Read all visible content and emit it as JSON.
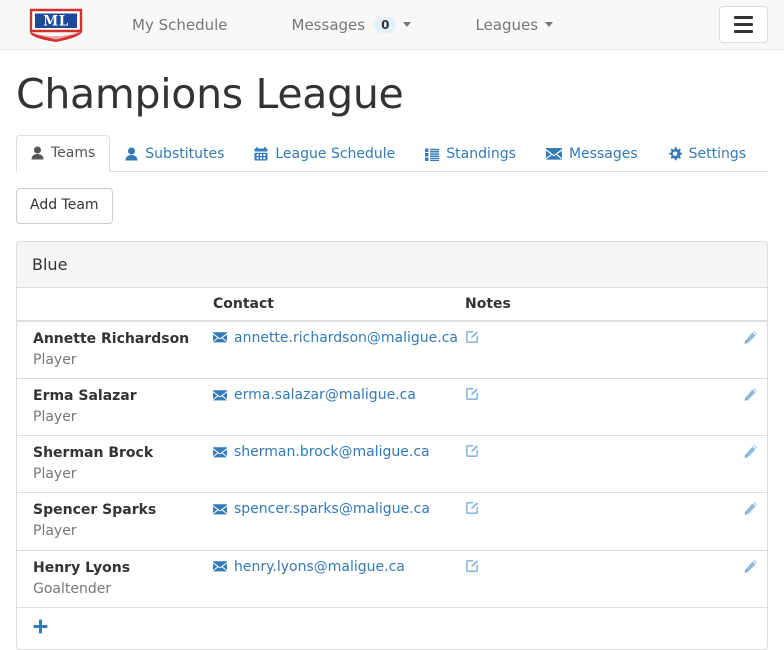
{
  "navbar": {
    "brand_text": "ML",
    "brand_icon": "ml-shield-logo",
    "links": [
      {
        "label": "My Schedule",
        "icon": null,
        "badge": null,
        "caret": false
      },
      {
        "label": "Messages",
        "icon": null,
        "badge": "0",
        "caret": true
      },
      {
        "label": "Leagues",
        "icon": null,
        "badge": null,
        "caret": true
      }
    ],
    "toggle_icon": "hamburger-icon"
  },
  "page": {
    "title": "Champions League"
  },
  "tabs": [
    {
      "label": "Teams",
      "icon": "user-icon",
      "active": true
    },
    {
      "label": "Substitutes",
      "icon": "user-icon",
      "active": false
    },
    {
      "label": "League Schedule",
      "icon": "calendar-icon",
      "active": false
    },
    {
      "label": "Standings",
      "icon": "list-icon",
      "active": false
    },
    {
      "label": "Messages",
      "icon": "envelope-icon",
      "active": false
    },
    {
      "label": "Settings",
      "icon": "gear-icon",
      "active": false
    }
  ],
  "toolbar": {
    "add_team_label": "Add Team"
  },
  "panel": {
    "team_name": "Blue",
    "columns": [
      "",
      "Contact",
      "Notes",
      ""
    ],
    "rows": [
      {
        "name": "Annette Richardson",
        "role": "Player",
        "email": "annette.richardson@maligue.ca",
        "notes_icon": "note-edit-icon",
        "edit_icon": "pencil-icon",
        "delete_icon": "remove-icon"
      },
      {
        "name": "Erma Salazar",
        "role": "Player",
        "email": "erma.salazar@maligue.ca",
        "notes_icon": "note-edit-icon",
        "edit_icon": "pencil-icon",
        "delete_icon": "remove-icon"
      },
      {
        "name": "Sherman Brock",
        "role": "Player",
        "email": "sherman.brock@maligue.ca",
        "notes_icon": "note-edit-icon",
        "edit_icon": "pencil-icon",
        "delete_icon": "remove-icon"
      },
      {
        "name": "Spencer Sparks",
        "role": "Player",
        "email": "spencer.sparks@maligue.ca",
        "notes_icon": "note-edit-icon",
        "edit_icon": "pencil-icon",
        "delete_icon": "remove-icon"
      },
      {
        "name": "Henry Lyons",
        "role": "Goaltender",
        "email": "henry.lyons@maligue.ca",
        "notes_icon": "note-edit-icon",
        "edit_icon": "pencil-icon",
        "delete_icon": "remove-icon"
      }
    ],
    "add_member_icon": "plus-icon"
  },
  "colors": {
    "link_blue": "#337ab7",
    "navbar_bg": "#f8f8f8",
    "panel_heading_bg": "#f5f5f5",
    "border": "#dddddd",
    "muted_text": "#777777",
    "logo_blue": "#1b4a9c",
    "logo_red": "#d0312d",
    "delete_red": "#f07070",
    "icon_light_blue": "#8fb8dd",
    "badge_bg": "#e1f0fa"
  }
}
